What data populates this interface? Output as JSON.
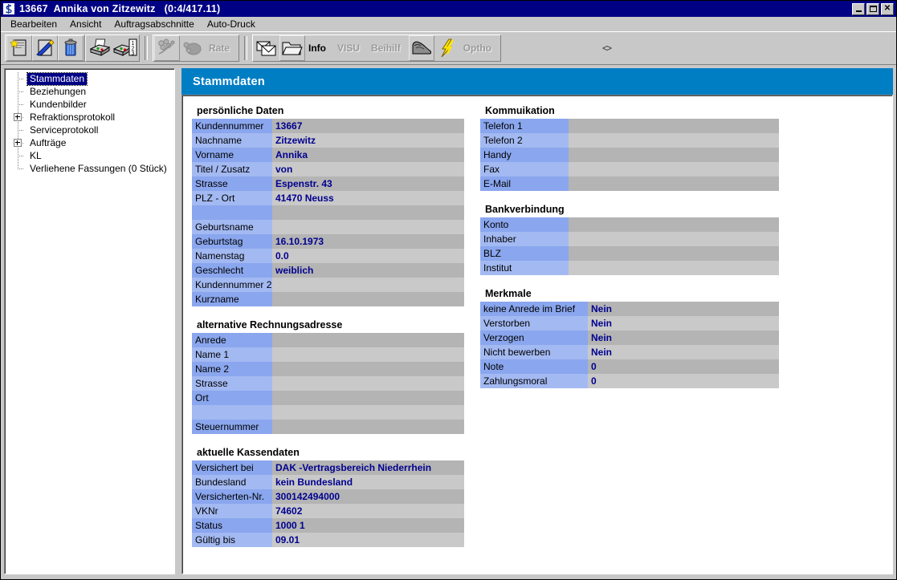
{
  "window": {
    "title": "13667  Annika von Zitzewitz   (0:4/417.11)",
    "icon": "app-logo-icon",
    "controls": {
      "minimize": "_",
      "maximize": "□",
      "close": "✕"
    }
  },
  "menubar": {
    "items": [
      "Bearbeiten",
      "Ansicht",
      "Auftragsabschnitte",
      "Auto-Druck"
    ]
  },
  "toolbar": {
    "groups": [
      {
        "buttons": [
          {
            "name": "new-document-icon",
            "label": "",
            "disabled": false
          },
          {
            "name": "edit-pen-icon",
            "label": "",
            "disabled": false
          },
          {
            "name": "delete-trash-icon",
            "label": "",
            "disabled": false
          }
        ]
      },
      {
        "buttons": [
          {
            "name": "print-icon",
            "label": "",
            "disabled": false
          },
          {
            "name": "print-numbered-icon",
            "label": "",
            "disabled": false
          }
        ]
      },
      {
        "buttons": [
          {
            "name": "glasses-icon",
            "label": "",
            "disabled": true
          },
          {
            "name": "rate-icon",
            "label": "Rate",
            "disabled": true
          }
        ]
      },
      {
        "buttons": [
          {
            "name": "mail-icon",
            "label": "",
            "disabled": false
          },
          {
            "name": "folder-icon",
            "label": "",
            "disabled": false
          },
          {
            "name": "info-icon",
            "label": "Info",
            "disabled": false
          },
          {
            "name": "visu-icon",
            "label": "VISU",
            "disabled": true
          },
          {
            "name": "beihilf-icon",
            "label": "Beihilf",
            "disabled": true
          },
          {
            "name": "shoe-icon",
            "label": "",
            "disabled": false
          },
          {
            "name": "lightning-icon",
            "label": "",
            "disabled": false
          },
          {
            "name": "optho-icon",
            "label": "Optho",
            "disabled": true
          }
        ]
      }
    ],
    "overflow_glyph": "<>"
  },
  "tree": {
    "items": [
      {
        "label": "Stammdaten",
        "expandable": false,
        "selected": true
      },
      {
        "label": "Beziehungen",
        "expandable": false,
        "selected": false
      },
      {
        "label": "Kundenbilder",
        "expandable": false,
        "selected": false
      },
      {
        "label": "Refraktionsprotokoll",
        "expandable": true,
        "selected": false
      },
      {
        "label": "Serviceprotokoll",
        "expandable": false,
        "selected": false
      },
      {
        "label": "Aufträge",
        "expandable": true,
        "selected": false
      },
      {
        "label": "KL",
        "expandable": false,
        "selected": false
      },
      {
        "label": "Verliehene Fassungen (0 Stück)",
        "expandable": false,
        "selected": false
      }
    ]
  },
  "content": {
    "header_title": "Stammdaten",
    "header_color": "#007ec4",
    "groups_left": [
      {
        "title": "persönliche Daten",
        "rows": [
          {
            "label": "Kundennummer",
            "value": "13667"
          },
          {
            "label": "Nachname",
            "value": "Zitzewitz"
          },
          {
            "label": "Vorname",
            "value": "Annika"
          },
          {
            "label": "Titel / Zusatz",
            "value": "von"
          },
          {
            "label": "Strasse",
            "value": "Espenstr. 43"
          },
          {
            "label": "PLZ - Ort",
            "value": "41470 Neuss"
          },
          {
            "label": "",
            "value": ""
          },
          {
            "label": "Geburtsname",
            "value": ""
          },
          {
            "label": "Geburtstag",
            "value": "16.10.1973"
          },
          {
            "label": "Namenstag",
            "value": "0.0"
          },
          {
            "label": "Geschlecht",
            "value": "weiblich"
          },
          {
            "label": "Kundennummer 2",
            "value": ""
          },
          {
            "label": "Kurzname",
            "value": ""
          }
        ]
      },
      {
        "title": "alternative Rechnungsadresse",
        "rows": [
          {
            "label": "Anrede",
            "value": ""
          },
          {
            "label": "Name 1",
            "value": ""
          },
          {
            "label": "Name 2",
            "value": ""
          },
          {
            "label": "Strasse",
            "value": ""
          },
          {
            "label": "Ort",
            "value": ""
          },
          {
            "label": "",
            "value": ""
          },
          {
            "label": "Steuernummer",
            "value": ""
          }
        ]
      },
      {
        "title": "aktuelle Kassendaten",
        "rows": [
          {
            "label": "Versichert bei",
            "value": "DAK -Vertragsbereich Niederrhein"
          },
          {
            "label": "Bundesland",
            "value": "kein Bundesland"
          },
          {
            "label": "Versicherten-Nr.",
            "value": "300142494000"
          },
          {
            "label": "VKNr",
            "value": "74602"
          },
          {
            "label": "Status",
            "value": "1000 1"
          },
          {
            "label": "Gültig bis",
            "value": "09.01"
          }
        ]
      }
    ],
    "groups_right": [
      {
        "title": "Kommuikation",
        "label_width": 110,
        "rows": [
          {
            "label": "Telefon 1",
            "value": ""
          },
          {
            "label": "Telefon 2",
            "value": ""
          },
          {
            "label": "Handy",
            "value": ""
          },
          {
            "label": "Fax",
            "value": ""
          },
          {
            "label": "E-Mail",
            "value": ""
          }
        ]
      },
      {
        "title": "Bankverbindung",
        "label_width": 110,
        "rows": [
          {
            "label": "Konto",
            "value": ""
          },
          {
            "label": "Inhaber",
            "value": ""
          },
          {
            "label": "BLZ",
            "value": ""
          },
          {
            "label": "Institut",
            "value": ""
          }
        ]
      },
      {
        "title": "Merkmale",
        "label_width": 134,
        "rows": [
          {
            "label": "keine Anrede im Brief",
            "value": "Nein"
          },
          {
            "label": "Verstorben",
            "value": "Nein"
          },
          {
            "label": "Verzogen",
            "value": "Nein"
          },
          {
            "label": "Nicht bewerben",
            "value": "Nein"
          },
          {
            "label": "Note",
            "value": "0"
          },
          {
            "label": "Zahlungsmoral",
            "value": "0"
          }
        ]
      }
    ]
  },
  "colors": {
    "titlebar": "#000084",
    "accent_header": "#007ec4",
    "label_dark": "#8aa6ee",
    "label_light": "#a3b9f2",
    "value_dark": "#b4b4b4",
    "value_light": "#c9c9c9",
    "value_text": "#00008f",
    "chrome": "#c8c8c8"
  }
}
